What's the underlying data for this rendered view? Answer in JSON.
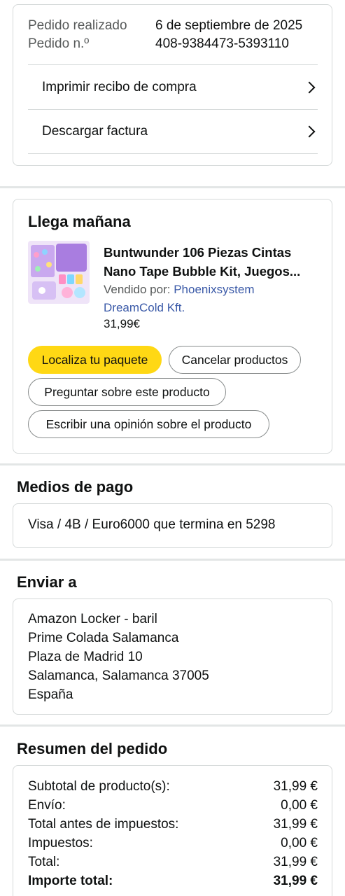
{
  "order_info": {
    "placed_label": "Pedido realizado",
    "placed_value": "6 de septiembre de 2025",
    "number_label": "Pedido n.º",
    "number_value": "408-9384473-5393110",
    "links": [
      "Imprimir recibo de compra",
      "Descargar factura"
    ]
  },
  "shipment": {
    "heading": "Llega mañana",
    "product_title_line1": "Buntwunder 106 Piezas Cintas",
    "product_title_line2": "Nano Tape Bubble Kit, Juegos...",
    "sold_by_label": "Vendido por: ",
    "seller_line1": "Phoenixsystem",
    "seller_line2": "DreamCold Kft.",
    "price": "31,99€",
    "buttons": {
      "track": "Localiza tu paquete",
      "cancel": "Cancelar productos",
      "ask": "Preguntar sobre este producto",
      "review": "Escribir una opinión sobre el producto"
    }
  },
  "payment": {
    "heading": "Medios de pago",
    "method": "Visa / 4B / Euro6000 que termina en 5298"
  },
  "shipping": {
    "heading": "Enviar a",
    "address": [
      "Amazon Locker - baril",
      "Prime Colada Salamanca",
      "Plaza de Madrid 10",
      "Salamanca, Salamanca 37005",
      "España"
    ]
  },
  "summary": {
    "heading": "Resumen del pedido",
    "rows": [
      {
        "label": "Subtotal de producto(s):",
        "value": "31,99 €"
      },
      {
        "label": "Envío:",
        "value": "0,00 €"
      },
      {
        "label": "Total antes de impuestos:",
        "value": "31,99 €"
      },
      {
        "label": "Impuestos:",
        "value": "0,00 €"
      },
      {
        "label": "Total:",
        "value": "31,99 €"
      },
      {
        "label": "Importe total:",
        "value": "31,99 €"
      }
    ]
  },
  "colors": {
    "accent_yellow": "#ffd814",
    "link_blue": "#3b5aa8",
    "border": "#d5d9d9"
  }
}
